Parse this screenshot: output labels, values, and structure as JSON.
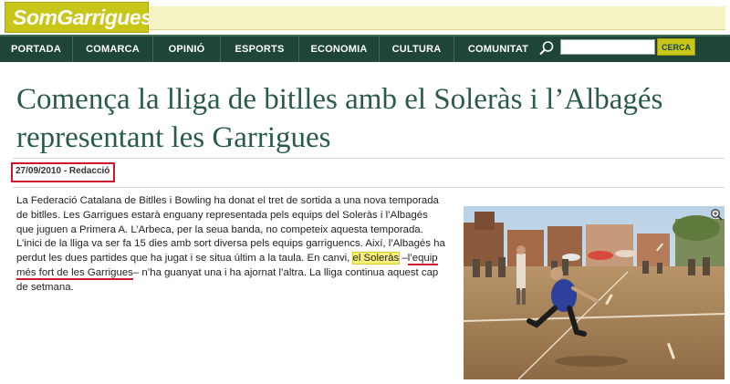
{
  "site": {
    "logo": "SomGarrigues"
  },
  "nav": {
    "items": [
      "PORTADA",
      "COMARCA",
      "OPINIÓ",
      "ESPORTS",
      "ECONOMIA",
      "CULTURA",
      "COMUNITAT"
    ]
  },
  "search": {
    "button_label": "CERCA",
    "value": ""
  },
  "article": {
    "title": "Comença la lliga de bitlles amb el Soleràs i l’Albagés representant les Garrigues",
    "meta": "27/09/2010 - Redacció",
    "body_part1": "La Federació Catalana de Bitlles i Bowling ha donat el tret de sortida a una nova temporada de bitlles. Les Garrigues estarà enguany representada pels equips del Soleràs i l’Albagés que juguen a Primera A. L’Arbeca, per la seua banda, no competeix aquesta temporada. L’inici de la lliga va ser fa 15 dies amb sort diversa pels equips garriguencs. Així, l’Albagés ha perdut les dues partides que ha jugat i se situa últim a la taula. En canvi, ",
    "body_highlight": "el Soleràs",
    "body_dash": " –",
    "body_underlined": "l’equip més fort de les Garrigues",
    "body_part2": "– n’ha guanyat una i ha ajornat l’altra. La lliga continua aquest cap de setmana."
  },
  "colors": {
    "nav_bg": "#1e4535",
    "logo_bg": "#c8c619",
    "title": "#2a5a4a",
    "annotation_red": "#d0182a",
    "highlight": "#f6f079"
  }
}
